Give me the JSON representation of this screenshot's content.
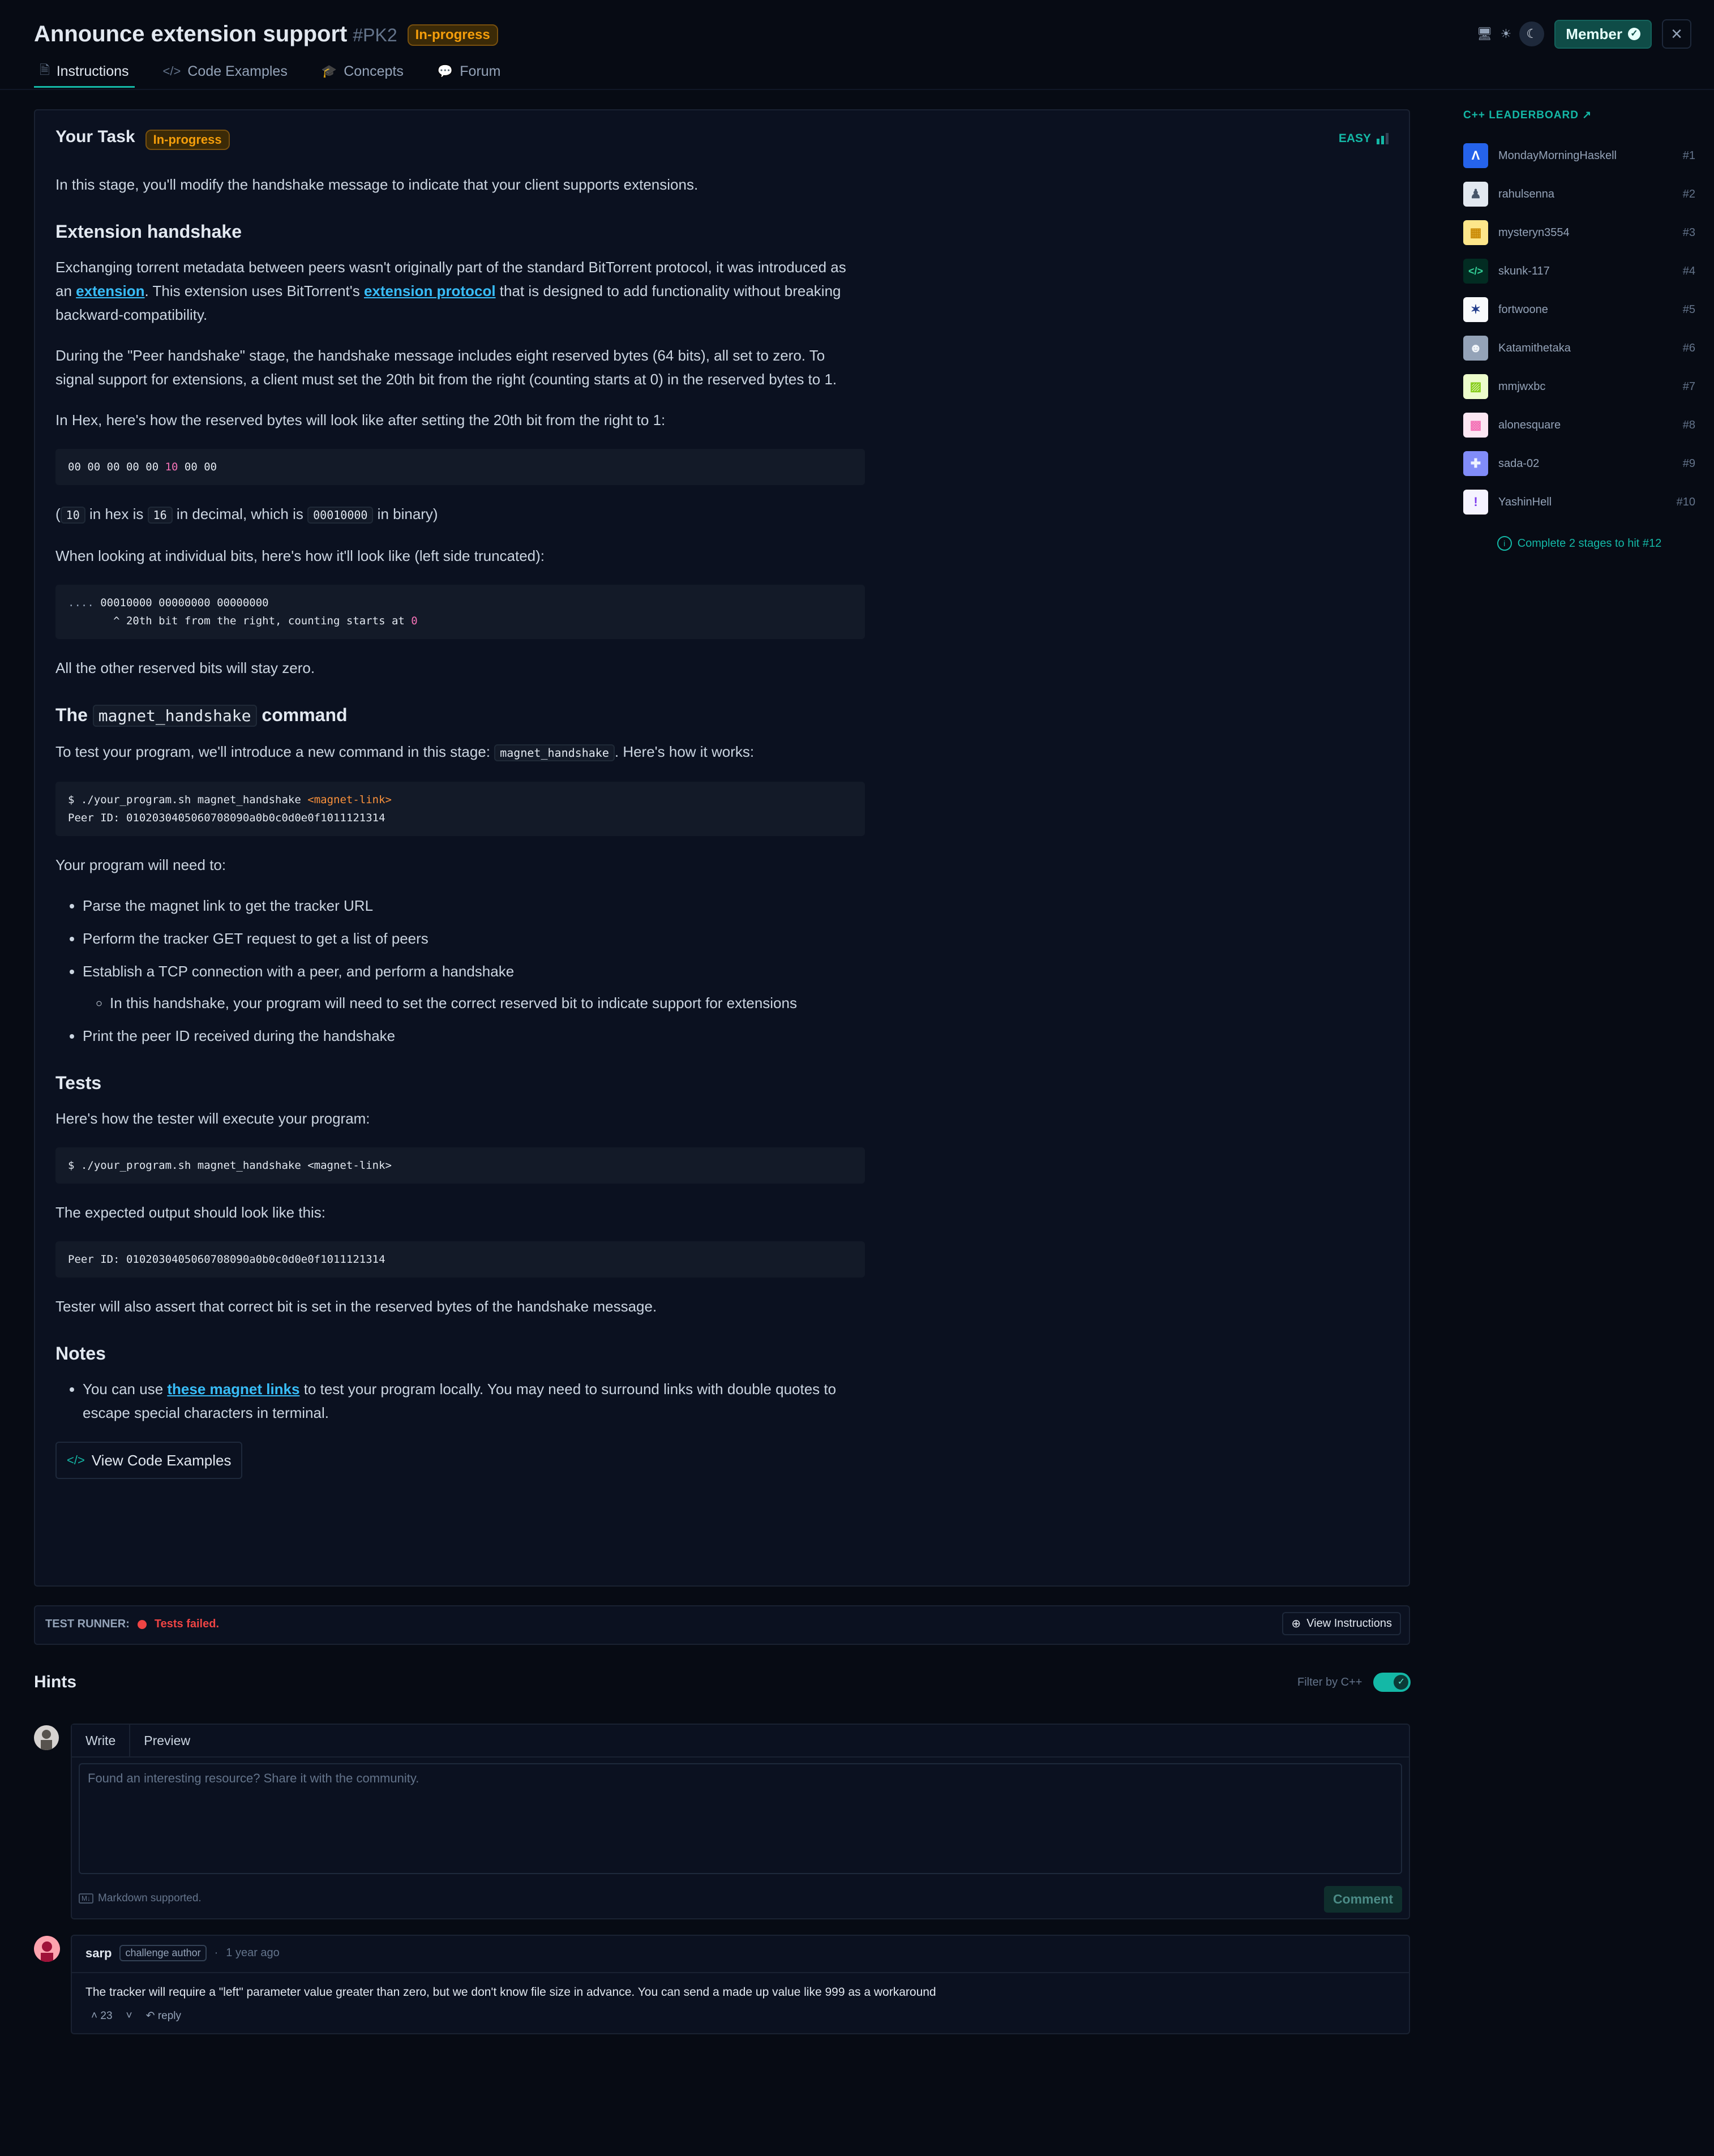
{
  "header": {
    "title": "Announce extension support",
    "slug": "#PK2",
    "status": "In-progress",
    "member_label": "Member",
    "tabs": [
      {
        "label": "Instructions"
      },
      {
        "label": "Code Examples"
      },
      {
        "label": "Concepts"
      },
      {
        "label": "Forum"
      }
    ]
  },
  "task": {
    "heading": "Your Task",
    "status": "In-progress",
    "difficulty": "EASY",
    "intro": "In this stage, you'll modify the handshake message to indicate that your client supports extensions.",
    "h_extension": "Extension handshake",
    "p1_a": "Exchanging torrent metadata between peers wasn't originally part of the standard BitTorrent protocol, it was introduced as an ",
    "p1_link1": "extension",
    "p1_b": ". This extension uses BitTorrent's ",
    "p1_link2": "extension protocol",
    "p1_c": " that is designed to add functionality without breaking backward-compatibility.",
    "p2": "During the \"Peer handshake\" stage, the handshake message includes eight reserved bytes (64 bits), all set to zero. To signal support for extensions, a client must set the 20th bit from the right (counting starts at 0) in the reserved bytes to 1.",
    "p3": "In Hex, here's how the reserved bytes will look like after setting the 20th bit from the right to 1:",
    "code1_a": "00 00 00 00 00 ",
    "code1_hl": "10",
    "code1_b": " 00 00",
    "p4_open": "(",
    "p4_c1": "10",
    "p4_t1": " in hex is ",
    "p4_c2": "16",
    "p4_t2": " in decimal, which is ",
    "p4_c3": "00010000",
    "p4_t3": " in binary)",
    "p5": "When looking at individual bits, here's how it'll look like (left side truncated):",
    "code2_dots": "....",
    "code2_line1": " 00010000 00000000 00000000",
    "code2_line2": "       ^ 20th bit from the right, counting starts at ",
    "code2_zero": "0",
    "p6": "All the other reserved bits will stay zero.",
    "h_cmd_pre": "The ",
    "h_cmd_code": "magnet_handshake",
    "h_cmd_post": " command",
    "p7_a": "To test your program, we'll introduce a new command in this stage: ",
    "p7_code": "magnet_handshake",
    "p7_b": ". Here's how it works:",
    "code3_line1": "$ ./your_program.sh magnet_handshake ",
    "code3_ph": "<magnet-link>",
    "code3_line2": "Peer ID: 0102030405060708090a0b0c0d0e0f1011121314",
    "p8": "Your program will need to:",
    "steps": [
      "Parse the magnet link to get the tracker URL",
      "Perform the tracker GET request to get a list of peers",
      "Establish a TCP connection with a peer, and perform a handshake",
      "Print the peer ID received during the handshake"
    ],
    "substep": "In this handshake, your program will need to set the correct reserved bit to indicate support for extensions",
    "h_tests": "Tests",
    "p9": "Here's how the tester will execute your program:",
    "code4": "$ ./your_program.sh magnet_handshake <magnet-link>",
    "p10": "The expected output should look like this:",
    "code5": "Peer ID: 0102030405060708090a0b0c0d0e0f1011121314",
    "p11": "Tester will also assert that correct bit is set in the reserved bytes of the handshake message.",
    "h_notes": "Notes",
    "note_a": "You can use ",
    "note_link": "these magnet links",
    "note_b": " to test your program locally. You may need to surround links with double quotes to escape special characters in terminal.",
    "view_code_label": "View Code Examples"
  },
  "runner": {
    "label": "TEST RUNNER:",
    "status": "Tests failed.",
    "view_label": "View Instructions"
  },
  "hints": {
    "title": "Hints",
    "filter_label": "Filter by C++",
    "filter_on": true,
    "tab_write": "Write",
    "tab_preview": "Preview",
    "placeholder": "Found an interesting resource? Share it with the community.",
    "markdown_note": "Markdown supported.",
    "md_icon_text": "M↓",
    "comment_label": "Comment",
    "comment": {
      "author": "sarp",
      "tag": "challenge author",
      "time": "1 year ago",
      "body": "The tracker will require a \"left\" parameter value greater than zero, but we don't know file size in advance. You can send a made up value like 999 as a workaround",
      "votes": "23",
      "reply_label": "reply"
    }
  },
  "leaderboard": {
    "title": "C++ LEADERBOARD",
    "entries": [
      {
        "name": "MondayMorningHaskell",
        "rank": "#1",
        "color": "#2563eb"
      },
      {
        "name": "rahulsenna",
        "rank": "#2",
        "color": "#475569"
      },
      {
        "name": "mysteryn3554",
        "rank": "#3",
        "color": "#ca8a04"
      },
      {
        "name": "skunk-117",
        "rank": "#4",
        "color": "#064e3b"
      },
      {
        "name": "fortwoone",
        "rank": "#5",
        "color": "#1e3a8a"
      },
      {
        "name": "Katamithetaka",
        "rank": "#6",
        "color": "#64748b"
      },
      {
        "name": "mmjwxbc",
        "rank": "#7",
        "color": "#84cc16"
      },
      {
        "name": "alonesquare",
        "rank": "#8",
        "color": "#f472b6"
      },
      {
        "name": "sada-02",
        "rank": "#9",
        "color": "#6366f1"
      },
      {
        "name": "YashinHell",
        "rank": "#10",
        "color": "#7c3aed"
      }
    ],
    "cta": "Complete 2 stages to hit #12"
  },
  "colors": {
    "accent": "#14b8a6",
    "in_progress": "#f59e0b",
    "failed": "#ef4444",
    "link": "#38bdf8",
    "background": "#070b14"
  },
  "icons": [
    "document-icon",
    "code-icon",
    "graduation-cap-icon",
    "chat-icon",
    "desktop-icon",
    "sun-icon",
    "moon-icon",
    "shield-check-icon",
    "close-icon",
    "info-icon",
    "plus-circle-icon",
    "check-icon",
    "arrow-up-icon",
    "chevron-down-icon",
    "reply-icon",
    "external-link-icon"
  ]
}
